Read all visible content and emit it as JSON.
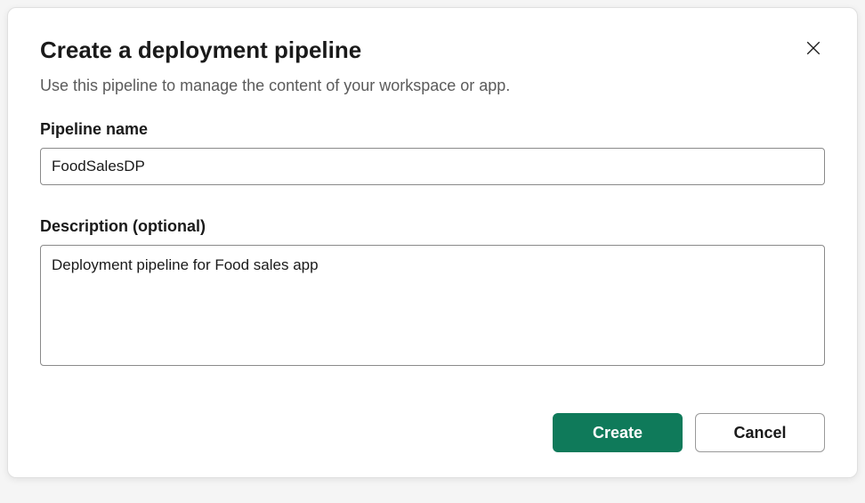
{
  "dialog": {
    "title": "Create a deployment pipeline",
    "subtitle": "Use this pipeline to manage the content of your workspace or app."
  },
  "form": {
    "pipeline_name": {
      "label": "Pipeline name",
      "value": "FoodSalesDP"
    },
    "description": {
      "label": "Description (optional)",
      "value": "Deployment pipeline for Food sales app"
    }
  },
  "buttons": {
    "create": "Create",
    "cancel": "Cancel"
  }
}
